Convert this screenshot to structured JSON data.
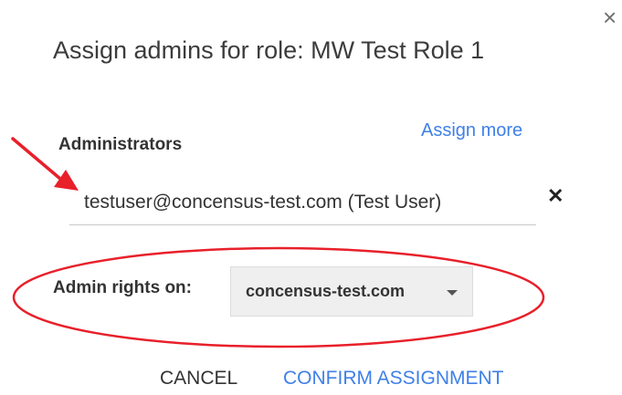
{
  "dialog": {
    "title": "Assign admins for role: MW Test Role 1",
    "close_glyph": "×"
  },
  "administrators": {
    "label": "Administrators",
    "assign_more": "Assign more",
    "value": "testuser@concensus-test.com (Test User)",
    "remove_glyph": "✕"
  },
  "admin_rights": {
    "label": "Admin rights on:",
    "selected": "concensus-test.com"
  },
  "actions": {
    "cancel": "CANCEL",
    "confirm": "CONFIRM ASSIGNMENT"
  },
  "annotation": {
    "color": "#e8202a",
    "icons": [
      "red-arrow",
      "red-ellipse"
    ]
  },
  "colors": {
    "accent": "#3f80e8",
    "text": "#333333"
  }
}
